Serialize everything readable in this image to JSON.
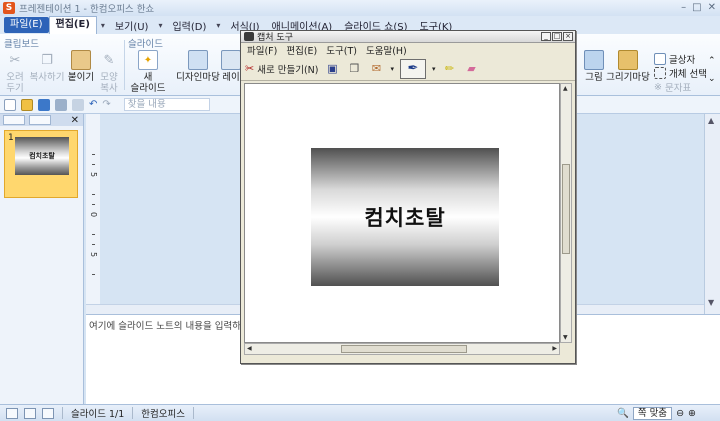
{
  "app": {
    "title": "프레젠테이션 1 - 한컴오피스 한쇼",
    "logo_letter": "S"
  },
  "menubar": {
    "items": [
      "파일(E)",
      "편집(E)",
      "보기(U)",
      "입력(D)",
      "서식(J)",
      "애니메이션(A)",
      "슬라이드 쇼(S)",
      "도구(K)"
    ]
  },
  "ribbon": {
    "clipboard_label": "클립보드",
    "slide_label": "슬라이드",
    "cut": "오려\n두기",
    "copy": "복사하기",
    "paste": "붙이기",
    "format_copy": "모양\n복사",
    "new_slide": "새\n슬라이드",
    "design_wizard": "디자인마당",
    "layout_partial": "레이",
    "picture": "그림",
    "drawing_wizard": "그리기마당",
    "textbox": "글상자",
    "object_select": "개체 선택",
    "char_table": "문자표"
  },
  "quicktoolbar": {
    "search_placeholder": "찾을 내용"
  },
  "slidepanel": {
    "slide_number": "1",
    "thumb_text": "컴치초탈"
  },
  "ruler": {
    "labels": [
      "5",
      "0",
      "5"
    ]
  },
  "notes": {
    "placeholder": "여기에 슬라이드 노트의 내용을 입력하십시오."
  },
  "statusbar": {
    "slide_info": "슬라이드 1/1",
    "app_name": "한컴오피스",
    "zoom": "쪽 맞춤"
  },
  "snip": {
    "title": "캡처 도구",
    "menu": [
      "파일(F)",
      "편집(E)",
      "도구(T)",
      "도움말(H)"
    ],
    "new_label": "새로 만들기(N)",
    "image_text": "컴치초탈"
  },
  "colors": {
    "accent": "#2d63b8",
    "ribbon_label": "#6482a8",
    "thumb_bg": "#ffd76e"
  }
}
